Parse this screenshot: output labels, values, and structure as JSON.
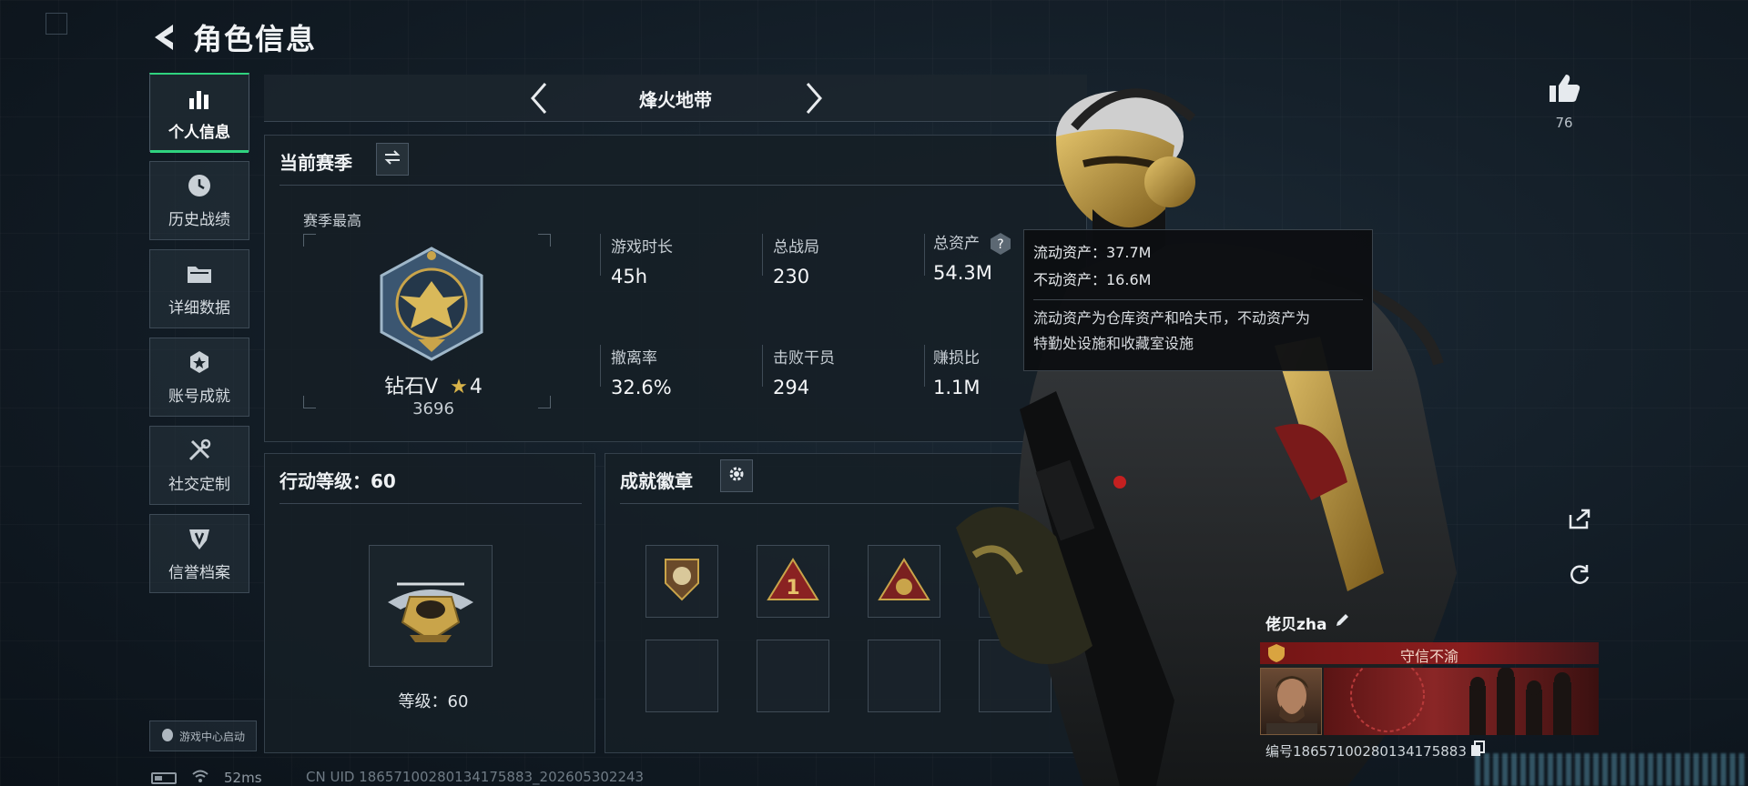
{
  "header": {
    "title": "角色信息"
  },
  "nav": {
    "items": [
      {
        "label": "个人信息",
        "icon": "bar-chart-icon",
        "active": true
      },
      {
        "label": "历史战绩",
        "icon": "clock-icon",
        "active": false
      },
      {
        "label": "详细数据",
        "icon": "folder-icon",
        "active": false
      },
      {
        "label": "账号成就",
        "icon": "achievement-icon",
        "active": false
      },
      {
        "label": "社交定制",
        "icon": "tools-icon",
        "active": false
      },
      {
        "label": "信誉档案",
        "icon": "shield-icon",
        "active": false
      }
    ],
    "launch_label": "游戏中心启动"
  },
  "season_nav": {
    "mode": "烽火地带"
  },
  "season_panel": {
    "title": "当前赛季",
    "best_label": "赛季最高",
    "rank_name": "钻石V",
    "rank_stars": "4",
    "rank_score": "3696",
    "stats": [
      {
        "label": "游戏时长",
        "value": "45h"
      },
      {
        "label": "总战局",
        "value": "230"
      },
      {
        "label": "总资产",
        "value": "54.3M"
      },
      {
        "label": "撤离率",
        "value": "32.6%"
      },
      {
        "label": "击败干员",
        "value": "294"
      },
      {
        "label": "赚损比",
        "value": "1.1M"
      }
    ]
  },
  "tooltip": {
    "liquid": "流动资产：37.7M",
    "fixed": "不动资产：16.6M",
    "desc_line1": "流动资产为仓库资产和哈夫币，不动资产为",
    "desc_line2": "特勤处设施和收藏室设施"
  },
  "action_level": {
    "title": "行动等级：60",
    "level_text": "等级：60"
  },
  "achievements": {
    "title": "成就徽章"
  },
  "like": {
    "count": "76"
  },
  "player": {
    "name": "佬贝zha",
    "credit": "守信不渝",
    "id_text": "编号18657100280134175883"
  },
  "status_bar": {
    "ping": "52ms",
    "uid": "CN UID 18657100280134175883_202605302243"
  },
  "colors": {
    "accent_green": "#2fd37f",
    "credit_red": "#8a2626",
    "gold": "#c9a44a"
  }
}
